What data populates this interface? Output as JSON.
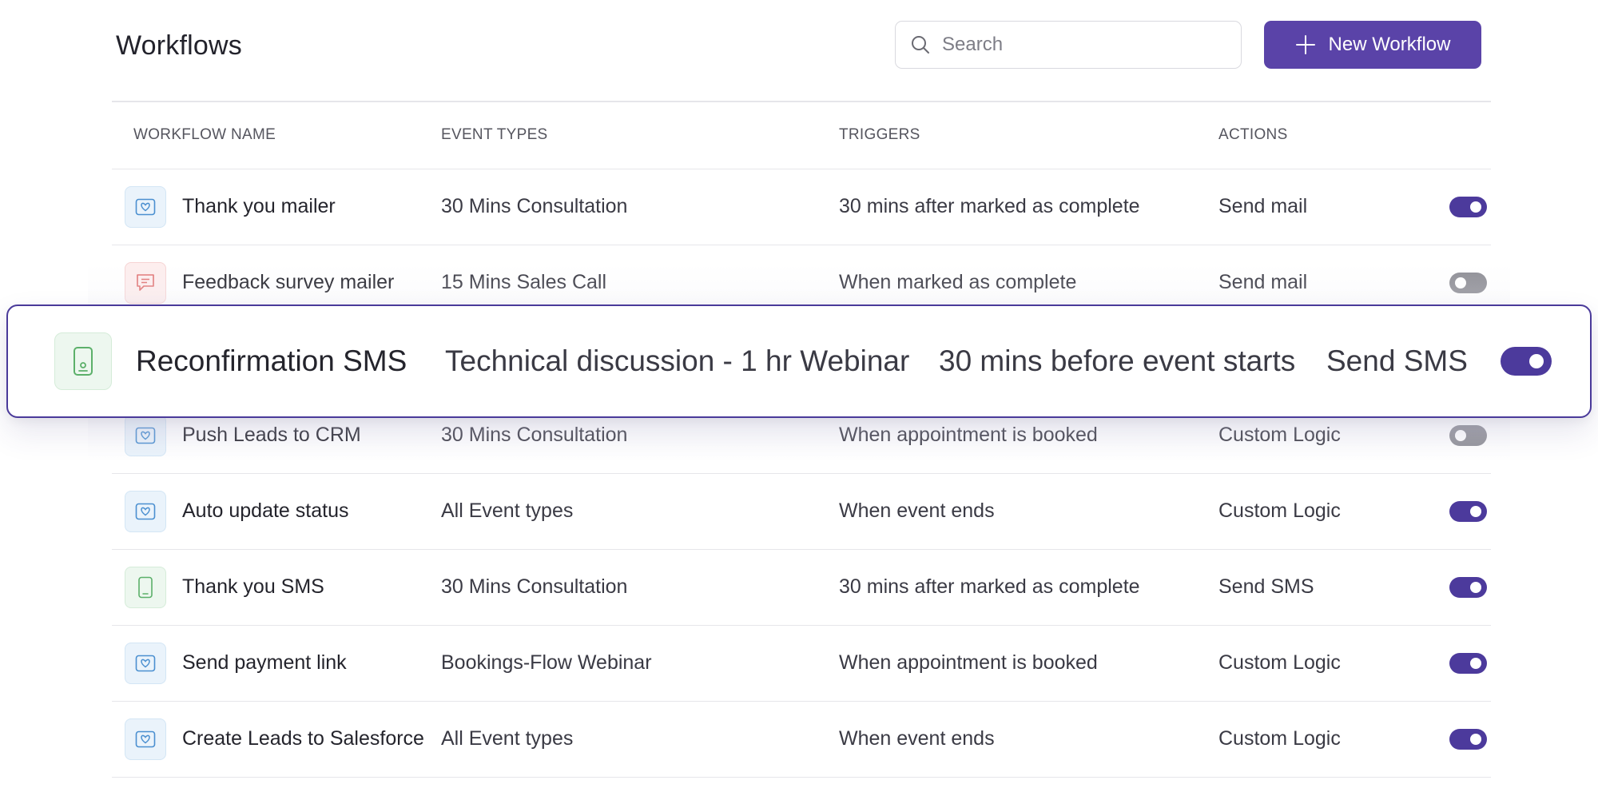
{
  "page": {
    "title": "Workflows"
  },
  "search": {
    "placeholder": "Search"
  },
  "new_button": {
    "label": "New Workflow"
  },
  "columns": {
    "name": "WORKFLOW NAME",
    "event": "EVENT TYPES",
    "trigger": "TRIGGERS",
    "action": "ACTIONS"
  },
  "rows": [
    {
      "name": "Thank you mailer",
      "event": "30 Mins Consultation",
      "trigger": "30 mins after marked as complete",
      "action": "Send mail",
      "enabled": true,
      "icon": "mail-icon"
    },
    {
      "name": "Feedback survey mailer",
      "event": "15 Mins Sales Call",
      "trigger": "When marked as complete",
      "action": "Send mail",
      "enabled": false,
      "icon": "chat-icon"
    },
    {
      "name": "Push Leads to CRM",
      "event": "30 Mins Consultation",
      "trigger": "When appointment is booked",
      "action": "Custom Logic",
      "enabled": false,
      "icon": "mail-icon"
    },
    {
      "name": "Auto update status",
      "event": "All Event types",
      "trigger": "When event ends",
      "action": "Custom Logic",
      "enabled": true,
      "icon": "mail-icon"
    },
    {
      "name": "Thank you SMS",
      "event": "30 Mins Consultation",
      "trigger": "30 mins after marked as complete",
      "action": "Send SMS",
      "enabled": true,
      "icon": "phone-icon"
    },
    {
      "name": "Send payment link",
      "event": "Bookings-Flow Webinar",
      "trigger": "When appointment is booked",
      "action": "Custom Logic",
      "enabled": true,
      "icon": "mail-icon"
    },
    {
      "name": "Create Leads to Salesforce",
      "event": "All Event types",
      "trigger": "When event ends",
      "action": "Custom Logic",
      "enabled": true,
      "icon": "mail-icon"
    }
  ],
  "highlighted": {
    "name": "Reconfirmation SMS",
    "event": "Technical discussion - 1 hr Webinar",
    "trigger": "30 mins before event starts",
    "action": "Send SMS",
    "enabled": true,
    "icon": "phone-icon"
  },
  "colors": {
    "accent": "#5a43a8",
    "toggle_on": "#4c3a9c",
    "toggle_off": "#8f8f96"
  }
}
